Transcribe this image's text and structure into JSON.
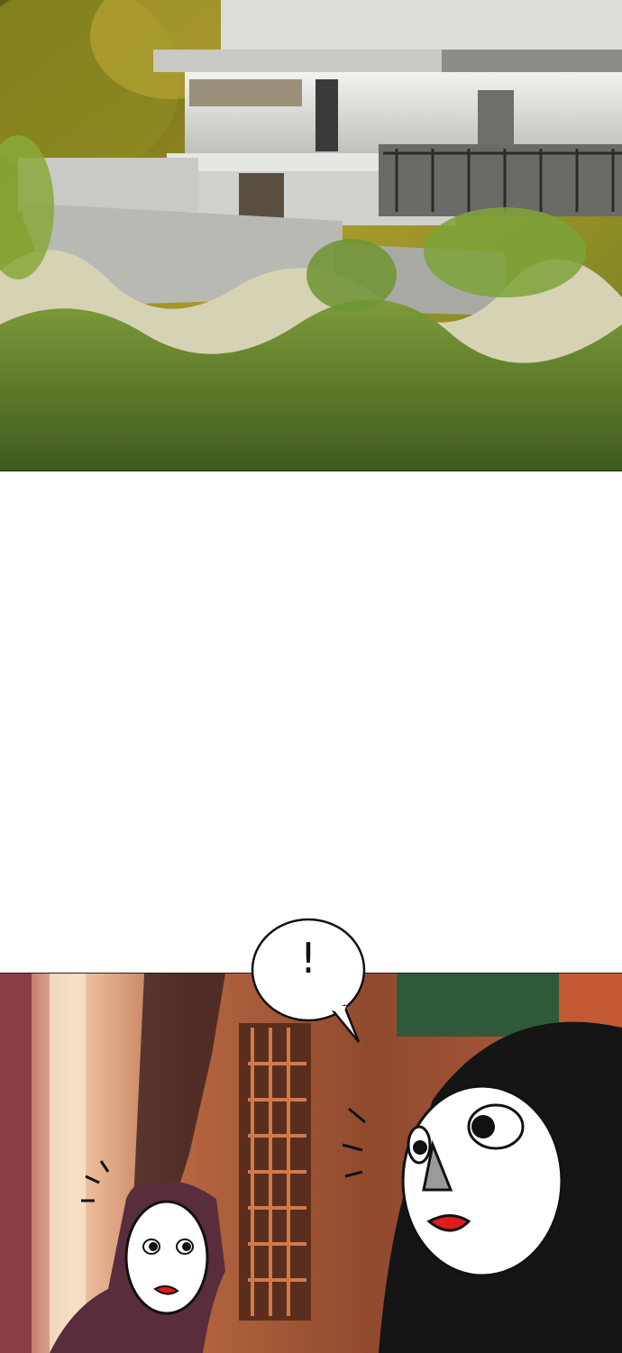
{
  "speech_bubble": {
    "text": "!"
  },
  "colors": {
    "sky_foliage": "#6b7a22",
    "building_wall": "#e9e9e6",
    "hedge_green": "#5d7a2a",
    "interior_wood": "#b0543a",
    "mask_white": "#ffffff",
    "hood_black": "#151515",
    "lips_red": "#e01b1b"
  },
  "icons": [
    "exclamation-icon"
  ]
}
